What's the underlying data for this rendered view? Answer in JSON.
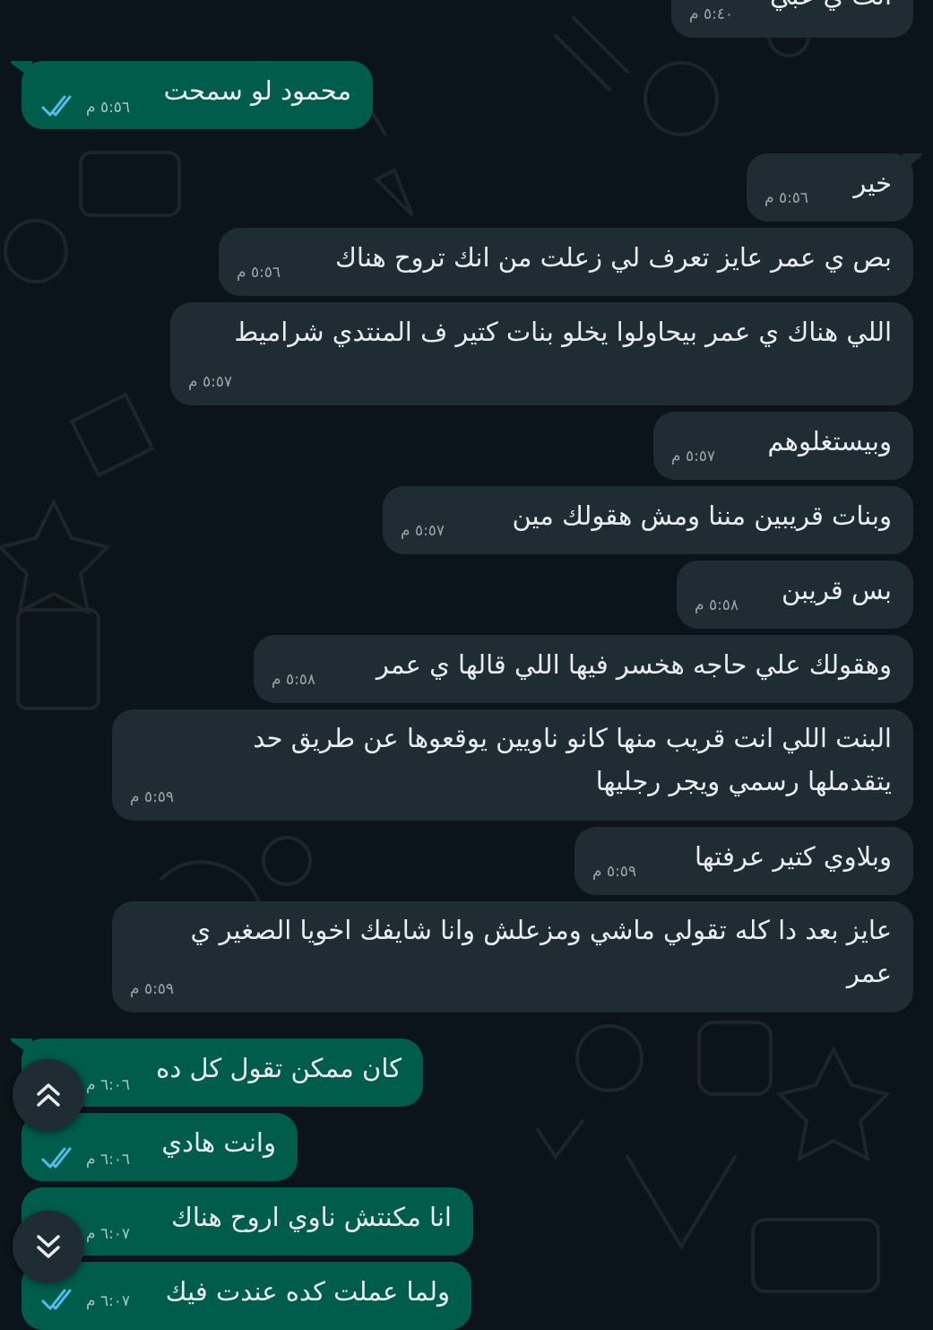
{
  "colors": {
    "background": "#0b141a",
    "incoming_bubble": "#202c33",
    "outgoing_bubble": "#005c4b",
    "text": "#e9edef",
    "read_ticks": "#53bdeb"
  },
  "messages": [
    {
      "dir": "in",
      "text": "انت ي عبي",
      "time": "٥:٤٠ م"
    },
    {
      "dir": "out",
      "text": "محمود لو سمحت",
      "time": "٥:٥٦ م",
      "status": "read"
    },
    {
      "dir": "in",
      "text": "خير",
      "time": "٥:٥٦ م"
    },
    {
      "dir": "in",
      "text": "بص ي عمر عايز تعرف لي زعلت من انك تروح هناك",
      "time": "٥:٥٦ م"
    },
    {
      "dir": "in",
      "text": "اللي هناك ي عمر بيحاولوا يخلو بنات كتير ف المنتدي شراميط",
      "time": "٥:٥٧ م"
    },
    {
      "dir": "in",
      "text": "وبيستغلوهم",
      "time": "٥:٥٧ م"
    },
    {
      "dir": "in",
      "text": "وبنات قريبين مننا ومش هقولك مين",
      "time": "٥:٥٧ م"
    },
    {
      "dir": "in",
      "text": "بس قريبن",
      "time": "٥:٥٨ م"
    },
    {
      "dir": "in",
      "text": "وهقولك علي حاجه هخسر فيها اللي قالها ي عمر",
      "time": "٥:٥٨ م"
    },
    {
      "dir": "in",
      "text": "البنت اللي انت قريب منها كانو ناويين يوقعوها عن طريق حد يتقدملها رسمي ويجر رجليها",
      "time": "٥:٥٩ م"
    },
    {
      "dir": "in",
      "text": "وبلاوي كتير عرفتها",
      "time": "٥:٥٩ م"
    },
    {
      "dir": "in",
      "text": "عايز بعد دا كله تقولي ماشي ومزعلش وانا شايفك اخويا الصغير ي عمر",
      "time": "٥:٥٩ م"
    },
    {
      "dir": "out",
      "text": "كان ممكن تقول كل ده",
      "time": "٦:٠٦ م",
      "status": "read"
    },
    {
      "dir": "out",
      "text": "وانت هادي",
      "time": "٦:٠٦ م",
      "status": "read"
    },
    {
      "dir": "out",
      "text": "انا مكنتش ناوي اروح هناك",
      "time": "٦:٠٧ م",
      "status": "read"
    },
    {
      "dir": "out",
      "text": "ولما عملت كده عندت فيك",
      "time": "٦:٠٧ م",
      "status": "read"
    }
  ],
  "controls": {
    "scroll_up_icon": "chevrons-up-icon",
    "scroll_down_icon": "chevrons-down-icon"
  }
}
